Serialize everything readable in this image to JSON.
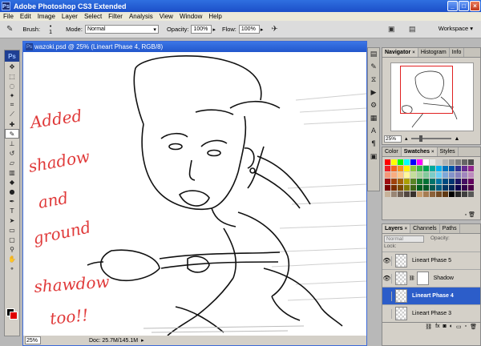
{
  "app": {
    "title": "Adobe Photoshop CS3 Extended",
    "logo": "Ps",
    "window_buttons": [
      "_",
      "□",
      "×"
    ]
  },
  "menu": [
    "File",
    "Edit",
    "Image",
    "Layer",
    "Select",
    "Filter",
    "Analysis",
    "View",
    "Window",
    "Help"
  ],
  "options": {
    "brush_label": "Brush:",
    "brush_size": "1",
    "mode_label": "Mode:",
    "mode_value": "Normal",
    "opacity_label": "Opacity:",
    "opacity_value": "100%",
    "flow_label": "Flow:",
    "flow_value": "100%",
    "workspace_label": "Workspace ▾"
  },
  "document": {
    "title": "wazoki.psd @ 25% (Lineart Phase 4, RGB/8)",
    "zoom": "25%",
    "doc_info": "Doc: 25.7M/145.1M",
    "annotation_lines": [
      "Added",
      "shadow",
      "and",
      "ground",
      "shawdow",
      "too!!"
    ],
    "annotation_color": "#e03a3a"
  },
  "navigator": {
    "tabs": [
      "Navigator",
      "Histogram",
      "Info"
    ],
    "zoom": "25%"
  },
  "swatches": {
    "tabs": [
      "Color",
      "Swatches",
      "Styles"
    ],
    "colors": [
      "#ff0000",
      "#ffff00",
      "#00ff00",
      "#00ffff",
      "#0000ff",
      "#ff00ff",
      "#ffffff",
      "#e6e6e6",
      "#cccccc",
      "#b3b3b3",
      "#999999",
      "#808080",
      "#666666",
      "#4d4d4d",
      "#ed1c24",
      "#f26522",
      "#f7941d",
      "#fff200",
      "#8dc63f",
      "#39b54a",
      "#00a651",
      "#00a99d",
      "#00aeef",
      "#0072bc",
      "#0054a6",
      "#2e3192",
      "#662d91",
      "#92278f",
      "#f69679",
      "#f9ad81",
      "#fdc68a",
      "#fff799",
      "#c4df9b",
      "#a3d39c",
      "#82ca9c",
      "#7accc8",
      "#6dcff6",
      "#7da7d9",
      "#8393ca",
      "#8781bd",
      "#a186be",
      "#bd8cbf",
      "#9e0b0f",
      "#a0410d",
      "#a36209",
      "#aba000",
      "#598527",
      "#1a7b30",
      "#007236",
      "#00746b",
      "#0076a3",
      "#004b80",
      "#003471",
      "#1b1464",
      "#440e62",
      "#630460",
      "#790000",
      "#7b2e00",
      "#7d4900",
      "#827b00",
      "#406618",
      "#005e20",
      "#005826",
      "#005952",
      "#005b7f",
      "#003663",
      "#002157",
      "#0d004c",
      "#32004b",
      "#4b0049",
      "#c7b299",
      "#998675",
      "#736357",
      "#534741",
      "#37302d",
      "#c69c6d",
      "#a67c52",
      "#8c6239",
      "#754c24",
      "#603913",
      "#000000",
      "#262626",
      "#404040",
      "#595959"
    ]
  },
  "layers": {
    "tabs": [
      "Layers",
      "Channels",
      "Paths"
    ],
    "blend_mode": "Normal",
    "opacity_text": "Opacity:",
    "lock_text": "Lock:",
    "items": [
      {
        "name": "Lineart Phase 5",
        "visible": true,
        "selected": false
      },
      {
        "name": "Shadow",
        "visible": true,
        "selected": false
      },
      {
        "name": "Lineart Phase 4",
        "visible": false,
        "selected": true
      },
      {
        "name": "Lineart Phase 3",
        "visible": false,
        "selected": false
      }
    ]
  },
  "toolbox": {
    "tools": [
      "move-icon",
      "marquee-icon",
      "lasso-icon",
      "magic-wand-icon",
      "crop-icon",
      "slice-icon",
      "healing-icon",
      "brush-icon",
      "stamp-icon",
      "history-brush-icon",
      "eraser-icon",
      "gradient-icon",
      "blur-icon",
      "dodge-icon",
      "pen-icon",
      "type-icon",
      "path-select-icon",
      "shape-icon",
      "notes-icon",
      "eyedropper-icon",
      "hand-icon",
      "zoom-icon"
    ]
  },
  "colors": {
    "foreground": "#000000",
    "background_swatch": "#e00000",
    "title_blue": "#2257cc"
  }
}
